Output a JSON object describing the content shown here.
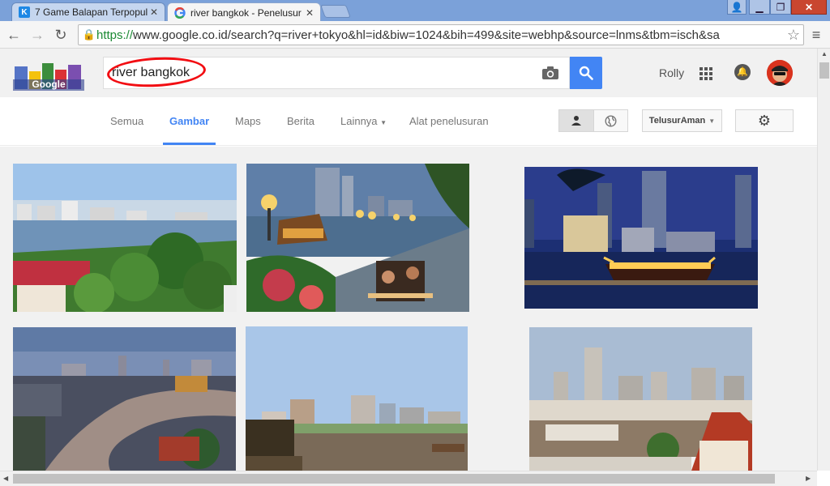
{
  "browser": {
    "tabs": [
      {
        "title": "7 Game Balapan Terpopul",
        "favicon": "k-icon",
        "active": false
      },
      {
        "title": "river bangkok - Penelusur",
        "favicon": "google-g-icon",
        "active": true
      }
    ],
    "url_scheme": "https://",
    "url_rest": "www.google.co.id/search?q=river+tokyo&hl=id&biw=1024&bih=499&site=webhp&source=lnms&tbm=isch&sa"
  },
  "google": {
    "query": "river bangkok",
    "user_name": "Rolly",
    "nav": {
      "tabs": [
        {
          "label": "Semua"
        },
        {
          "label": "Gambar"
        },
        {
          "label": "Maps"
        },
        {
          "label": "Berita"
        },
        {
          "label": "Lainnya"
        },
        {
          "label": "Alat penelusuran"
        }
      ],
      "active_tab": "Gambar",
      "safesearch_label": "TelusurAman"
    }
  },
  "colors": {
    "accent": "#4285f4",
    "annotation": "#f20d12",
    "tab_bar": "#7ba1d9"
  },
  "images": [
    {
      "name": "bangkok-river-aerial"
    },
    {
      "name": "riverside-restaurant-dusk"
    },
    {
      "name": "night-dinner-boat"
    },
    {
      "name": "river-bend-evening"
    },
    {
      "name": "river-skyline-day"
    },
    {
      "name": "river-temple-roofs"
    }
  ]
}
